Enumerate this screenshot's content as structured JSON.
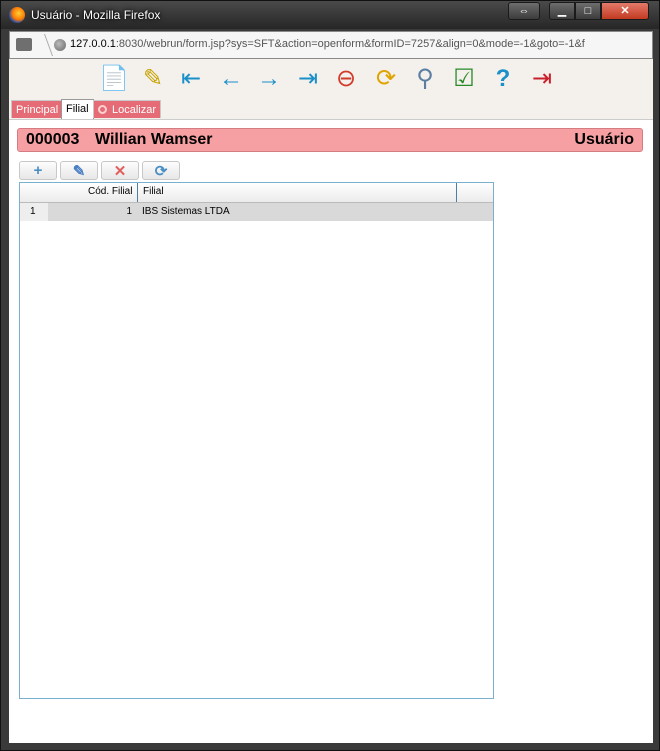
{
  "window": {
    "title": "Usuário - Mozilla Firefox",
    "resize_glyph": "⇔",
    "min_glyph": "▁",
    "max_glyph": "□",
    "close_glyph": "✕"
  },
  "address": {
    "host": "127.0.0.1",
    "rest": ":8030/webrun/form.jsp?sys=SFT&action=openform&formID=7257&align=0&mode=-1&goto=-1&f"
  },
  "toolbar": {
    "icons": [
      {
        "name": "new-record-icon",
        "glyph": "📄",
        "color": "#2a9d2a"
      },
      {
        "name": "edit-record-icon",
        "glyph": "✎",
        "color": "#c7a300"
      },
      {
        "name": "first-record-icon",
        "glyph": "⇤",
        "color": "#1a8fc8"
      },
      {
        "name": "previous-record-icon",
        "glyph": "←",
        "color": "#1a8fc8"
      },
      {
        "name": "next-record-icon",
        "glyph": "→",
        "color": "#1a8fc8"
      },
      {
        "name": "last-record-icon",
        "glyph": "⇥",
        "color": "#1a8fc8"
      },
      {
        "name": "delete-record-icon",
        "glyph": "⊖",
        "color": "#d23a2a"
      },
      {
        "name": "refresh-icon",
        "glyph": "⟳",
        "color": "#e0a400"
      },
      {
        "name": "search-icon",
        "glyph": "⚲",
        "color": "#5a7fa3"
      },
      {
        "name": "report-icon",
        "glyph": "☑",
        "color": "#2a8a2a"
      },
      {
        "name": "help-icon",
        "glyph": "?",
        "color": "#1a8fc8"
      },
      {
        "name": "exit-icon",
        "glyph": "⇥",
        "color": "#c8202a"
      }
    ]
  },
  "tabs": [
    {
      "label": "Principal"
    },
    {
      "label": "Filial"
    },
    {
      "label": "Localizar"
    }
  ],
  "header": {
    "record_code": "000003",
    "record_name": "Willian Wamser",
    "entity": "Usuário"
  },
  "grid_toolbar": {
    "add_glyph": "+",
    "edit_glyph": "✎",
    "delete_glyph": "✕",
    "refresh_glyph": "⟳"
  },
  "grid": {
    "columns": [
      "Cód. Filial",
      "Filial"
    ],
    "rows": [
      {
        "num": "1",
        "cod": "1",
        "filial": "IBS Sistemas LTDA"
      }
    ]
  },
  "colors": {
    "accent_tab": "#e56c76",
    "header_band": "#f7a0a3",
    "grid_border": "#7ab0cf"
  }
}
